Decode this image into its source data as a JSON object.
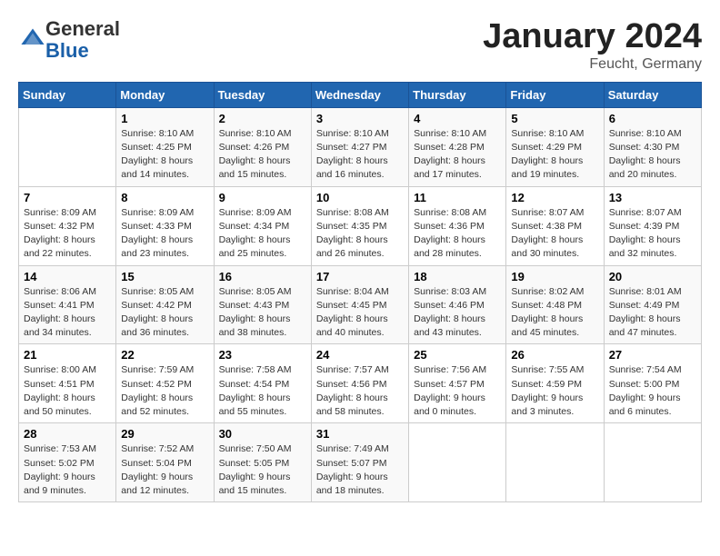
{
  "logo": {
    "general": "General",
    "blue": "Blue"
  },
  "title": "January 2024",
  "location": "Feucht, Germany",
  "days_header": [
    "Sunday",
    "Monday",
    "Tuesday",
    "Wednesday",
    "Thursday",
    "Friday",
    "Saturday"
  ],
  "weeks": [
    [
      {
        "num": "",
        "info": ""
      },
      {
        "num": "1",
        "info": "Sunrise: 8:10 AM\nSunset: 4:25 PM\nDaylight: 8 hours\nand 14 minutes."
      },
      {
        "num": "2",
        "info": "Sunrise: 8:10 AM\nSunset: 4:26 PM\nDaylight: 8 hours\nand 15 minutes."
      },
      {
        "num": "3",
        "info": "Sunrise: 8:10 AM\nSunset: 4:27 PM\nDaylight: 8 hours\nand 16 minutes."
      },
      {
        "num": "4",
        "info": "Sunrise: 8:10 AM\nSunset: 4:28 PM\nDaylight: 8 hours\nand 17 minutes."
      },
      {
        "num": "5",
        "info": "Sunrise: 8:10 AM\nSunset: 4:29 PM\nDaylight: 8 hours\nand 19 minutes."
      },
      {
        "num": "6",
        "info": "Sunrise: 8:10 AM\nSunset: 4:30 PM\nDaylight: 8 hours\nand 20 minutes."
      }
    ],
    [
      {
        "num": "7",
        "info": "Sunrise: 8:09 AM\nSunset: 4:32 PM\nDaylight: 8 hours\nand 22 minutes."
      },
      {
        "num": "8",
        "info": "Sunrise: 8:09 AM\nSunset: 4:33 PM\nDaylight: 8 hours\nand 23 minutes."
      },
      {
        "num": "9",
        "info": "Sunrise: 8:09 AM\nSunset: 4:34 PM\nDaylight: 8 hours\nand 25 minutes."
      },
      {
        "num": "10",
        "info": "Sunrise: 8:08 AM\nSunset: 4:35 PM\nDaylight: 8 hours\nand 26 minutes."
      },
      {
        "num": "11",
        "info": "Sunrise: 8:08 AM\nSunset: 4:36 PM\nDaylight: 8 hours\nand 28 minutes."
      },
      {
        "num": "12",
        "info": "Sunrise: 8:07 AM\nSunset: 4:38 PM\nDaylight: 8 hours\nand 30 minutes."
      },
      {
        "num": "13",
        "info": "Sunrise: 8:07 AM\nSunset: 4:39 PM\nDaylight: 8 hours\nand 32 minutes."
      }
    ],
    [
      {
        "num": "14",
        "info": "Sunrise: 8:06 AM\nSunset: 4:41 PM\nDaylight: 8 hours\nand 34 minutes."
      },
      {
        "num": "15",
        "info": "Sunrise: 8:05 AM\nSunset: 4:42 PM\nDaylight: 8 hours\nand 36 minutes."
      },
      {
        "num": "16",
        "info": "Sunrise: 8:05 AM\nSunset: 4:43 PM\nDaylight: 8 hours\nand 38 minutes."
      },
      {
        "num": "17",
        "info": "Sunrise: 8:04 AM\nSunset: 4:45 PM\nDaylight: 8 hours\nand 40 minutes."
      },
      {
        "num": "18",
        "info": "Sunrise: 8:03 AM\nSunset: 4:46 PM\nDaylight: 8 hours\nand 43 minutes."
      },
      {
        "num": "19",
        "info": "Sunrise: 8:02 AM\nSunset: 4:48 PM\nDaylight: 8 hours\nand 45 minutes."
      },
      {
        "num": "20",
        "info": "Sunrise: 8:01 AM\nSunset: 4:49 PM\nDaylight: 8 hours\nand 47 minutes."
      }
    ],
    [
      {
        "num": "21",
        "info": "Sunrise: 8:00 AM\nSunset: 4:51 PM\nDaylight: 8 hours\nand 50 minutes."
      },
      {
        "num": "22",
        "info": "Sunrise: 7:59 AM\nSunset: 4:52 PM\nDaylight: 8 hours\nand 52 minutes."
      },
      {
        "num": "23",
        "info": "Sunrise: 7:58 AM\nSunset: 4:54 PM\nDaylight: 8 hours\nand 55 minutes."
      },
      {
        "num": "24",
        "info": "Sunrise: 7:57 AM\nSunset: 4:56 PM\nDaylight: 8 hours\nand 58 minutes."
      },
      {
        "num": "25",
        "info": "Sunrise: 7:56 AM\nSunset: 4:57 PM\nDaylight: 9 hours\nand 0 minutes."
      },
      {
        "num": "26",
        "info": "Sunrise: 7:55 AM\nSunset: 4:59 PM\nDaylight: 9 hours\nand 3 minutes."
      },
      {
        "num": "27",
        "info": "Sunrise: 7:54 AM\nSunset: 5:00 PM\nDaylight: 9 hours\nand 6 minutes."
      }
    ],
    [
      {
        "num": "28",
        "info": "Sunrise: 7:53 AM\nSunset: 5:02 PM\nDaylight: 9 hours\nand 9 minutes."
      },
      {
        "num": "29",
        "info": "Sunrise: 7:52 AM\nSunset: 5:04 PM\nDaylight: 9 hours\nand 12 minutes."
      },
      {
        "num": "30",
        "info": "Sunrise: 7:50 AM\nSunset: 5:05 PM\nDaylight: 9 hours\nand 15 minutes."
      },
      {
        "num": "31",
        "info": "Sunrise: 7:49 AM\nSunset: 5:07 PM\nDaylight: 9 hours\nand 18 minutes."
      },
      {
        "num": "",
        "info": ""
      },
      {
        "num": "",
        "info": ""
      },
      {
        "num": "",
        "info": ""
      }
    ]
  ]
}
